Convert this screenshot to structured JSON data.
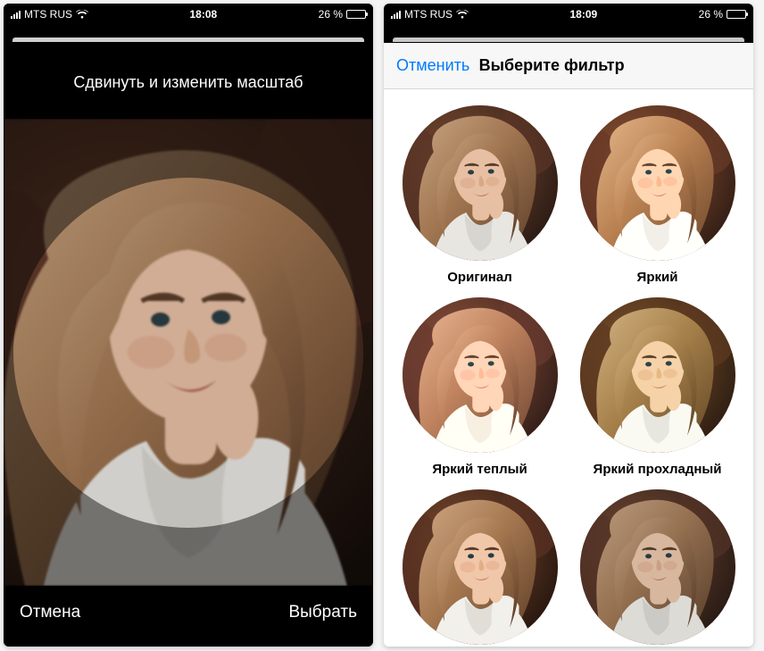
{
  "status": {
    "carrier": "MTS RUS",
    "wifi": true,
    "battery_text": "26 %",
    "battery_pct": 26
  },
  "left": {
    "time": "18:08",
    "title": "Сдвинуть и изменить масштаб",
    "cancel_label": "Отмена",
    "choose_label": "Выбрать"
  },
  "right": {
    "time": "18:09",
    "cancel_label": "Отменить",
    "title": "Выберите фильтр",
    "filters": [
      {
        "label": "Оригинал",
        "tint": ""
      },
      {
        "label": "Яркий",
        "tint": "tint-bright"
      },
      {
        "label": "Яркий теплый",
        "tint": "tint-warm"
      },
      {
        "label": "Яркий прохладный",
        "tint": "tint-cool"
      },
      {
        "label": "",
        "tint": "tint-row3a"
      },
      {
        "label": "",
        "tint": "tint-row3b"
      }
    ]
  }
}
